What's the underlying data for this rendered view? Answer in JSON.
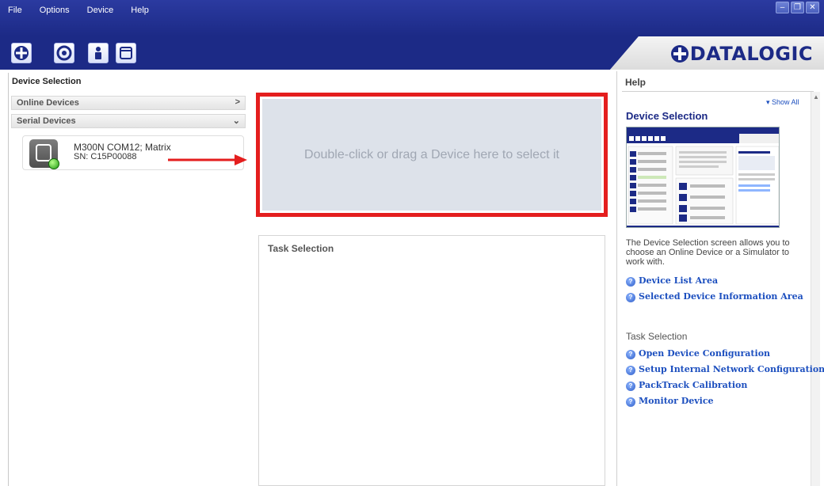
{
  "menu": [
    "File",
    "Options",
    "Device",
    "Help"
  ],
  "window_controls": [
    "minimize-icon",
    "restore-icon",
    "close-icon"
  ],
  "toolbar": {
    "buttons": [
      "device-selection-icon",
      "configuration-icon",
      "info-icon",
      "window-icon"
    ],
    "logo_text": "DATALOGIC"
  },
  "device_panel": {
    "title": "Device Selection",
    "online_label": "Online Devices",
    "serial_label": "Serial Devices",
    "device": {
      "name": "M300N COM12; Matrix",
      "sn": "SN: C15P00088"
    }
  },
  "dropzone": {
    "text": "Double-click or drag a Device here to select it"
  },
  "task": {
    "title": "Task Selection"
  },
  "help": {
    "title": "Help",
    "show_all": "▾ Show All",
    "section_title": "Device Selection",
    "description": "The Device Selection screen allows you to choose an Online Device or a Simulator to work with.",
    "links_top": [
      "Device List Area",
      "Selected Device Information Area"
    ],
    "task_heading": "Task Selection",
    "task_links": [
      "Open Device Configuration",
      "Setup Internal Network Configuration",
      "PackTrack Calibration",
      "Monitor Device"
    ]
  },
  "colors": {
    "brand": "#1c2a86",
    "highlight": "#e41e1e",
    "link": "#1c4fbf"
  }
}
